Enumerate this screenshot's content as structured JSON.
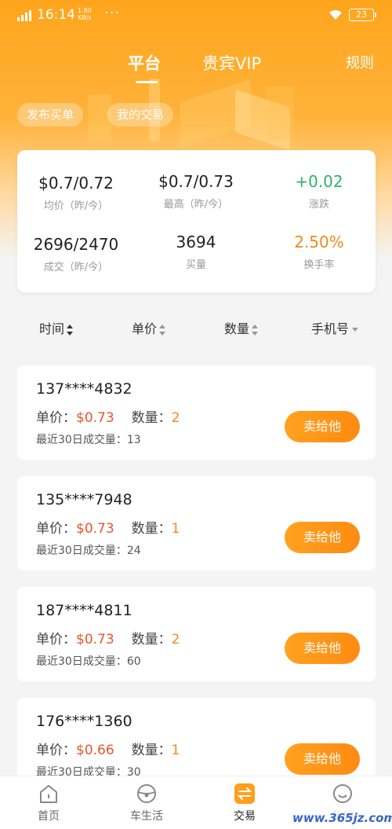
{
  "status_bar": {
    "time": "16:14",
    "speed_value": "1.80",
    "speed_unit": "KB/s",
    "dots": "···",
    "battery": "23"
  },
  "header": {
    "tabs": [
      {
        "label": "平台",
        "active": true
      },
      {
        "label": "贵宾VIP",
        "active": false
      }
    ],
    "rules_label": "规则",
    "pills": [
      "发布买单",
      "我的交易"
    ]
  },
  "stats": [
    {
      "value": "$0.7/0.72",
      "label": "均价（昨/今）",
      "color": "#222222"
    },
    {
      "value": "$0.7/0.73",
      "label": "最高（昨/今）",
      "color": "#222222"
    },
    {
      "value": "+0.02",
      "label": "涨跌",
      "color": "#2db36b"
    },
    {
      "value": "2696/2470",
      "label": "成交（昨/今）",
      "color": "#222222"
    },
    {
      "value": "3694",
      "label": "买量",
      "color": "#222222"
    },
    {
      "value": "2.50%",
      "label": "换手率",
      "color": "#f08a1a"
    }
  ],
  "sort_bar": {
    "time": "时间",
    "price": "单价",
    "quantity": "数量",
    "phone": "手机号"
  },
  "orders": [
    {
      "phone": "137****4832",
      "price_label": "单价：",
      "price": "$0.73",
      "qty_label": "数量：",
      "qty": "2",
      "volume": "最近30日成交量：13",
      "button": "卖给他"
    },
    {
      "phone": "135****7948",
      "price_label": "单价：",
      "price": "$0.73",
      "qty_label": "数量：",
      "qty": "1",
      "volume": "最近30日成交量：24",
      "button": "卖给他"
    },
    {
      "phone": "187****4811",
      "price_label": "单价：",
      "price": "$0.73",
      "qty_label": "数量：",
      "qty": "2",
      "volume": "最近30日成交量：60",
      "button": "卖给他"
    },
    {
      "phone": "176****1360",
      "price_label": "单价：",
      "price": "$0.66",
      "qty_label": "数量：",
      "qty": "1",
      "volume": "最近30日成交量：30",
      "button": "卖给他"
    }
  ],
  "bottom_nav": [
    {
      "label": "首页",
      "icon": "home-icon"
    },
    {
      "label": "车生活",
      "icon": "steering-wheel-icon"
    },
    {
      "label": "交易",
      "icon": "exchange-icon",
      "active": true
    },
    {
      "label": "我的",
      "icon": "smiley-icon"
    }
  ],
  "watermark": "www.365jz.com",
  "colors": {
    "brand_orange": "#ff9f1c",
    "price_red": "#e8562a",
    "qty_orange": "#f08a1a",
    "positive_green": "#2db36b"
  }
}
